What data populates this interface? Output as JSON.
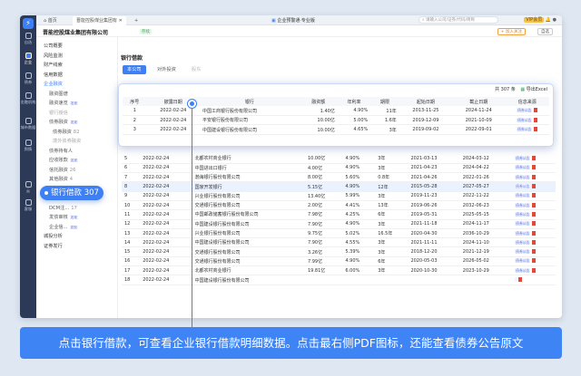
{
  "app": {
    "title": "企业预警通·专业版",
    "search_placeholder": "请输入公司/证券/代码/简称",
    "vip_label": "VIP会员"
  },
  "tabs": [
    {
      "label": "首页"
    },
    {
      "label": "晋能控股煤业集团有"
    }
  ],
  "company": {
    "name": "晋能控股煤业集团有限公司",
    "status_badge": "存续",
    "follow_label": "+ 加入关注",
    "select_label": "自选"
  },
  "rail": [
    {
      "label": "自选"
    },
    {
      "label": "企业"
    },
    {
      "label": "债券"
    },
    {
      "label": "金融机构"
    },
    {
      "label": "城市数据"
    },
    {
      "label": "舆情"
    },
    {
      "label": "云"
    },
    {
      "label": "客服"
    }
  ],
  "leftnav": [
    {
      "label": "公司概要"
    },
    {
      "label": "风险监测"
    },
    {
      "label": "财产线索"
    },
    {
      "label": "信用数据"
    },
    {
      "label": "企业融资"
    },
    {
      "label": "融资图谱"
    },
    {
      "label": "融资速览",
      "tag": "发现"
    },
    {
      "label": "银行授信"
    },
    {
      "label": "债券融资",
      "tag": "发现"
    },
    {
      "label": "债券融资",
      "count": "82"
    },
    {
      "label": "境外债券融资"
    },
    {
      "label": "债券持有人"
    },
    {
      "label": "应收账款",
      "tag": "发现"
    },
    {
      "label": "信托融资",
      "count": "26"
    },
    {
      "label": "其他融资",
      "count": "4"
    },
    {
      "label": "授信额度",
      "count": "40"
    },
    {
      "label": "DCM注...",
      "count": "69"
    },
    {
      "label": "DCM注...",
      "count": "17"
    },
    {
      "label": "发债审核",
      "tag": "发现"
    },
    {
      "label": "企业信...",
      "tag": "发现"
    },
    {
      "label": "城投分析"
    },
    {
      "label": "证券发行"
    }
  ],
  "callout": {
    "label": "银行借款",
    "count": "307"
  },
  "section": {
    "title": "银行借款",
    "subtabs": [
      "本公司",
      "对外投资",
      "股东"
    ]
  },
  "table": {
    "total_label": "共 307 条",
    "export_label": "导出Excel",
    "headers": [
      "序号",
      "披露日期",
      "银行",
      "融资额",
      "年利率",
      "期限",
      "起始日期",
      "截止日期",
      "信息来源"
    ],
    "top_rows": [
      {
        "no": "1",
        "date": "2022-02-24",
        "bank": "中国工商银行股份有限公司",
        "amount": "1.40亿",
        "rate": "4.90%",
        "term": "11年",
        "start": "2013-11-25",
        "end": "2024-11-24",
        "source": "债券公告"
      },
      {
        "no": "2",
        "date": "2022-02-24",
        "bank": "平安银行股份有限公司",
        "amount": "10.00亿",
        "rate": "5.00%",
        "term": "1.6年",
        "start": "2019-12-09",
        "end": "2021-10-09",
        "source": "债券公告"
      },
      {
        "no": "3",
        "date": "2022-02-24",
        "bank": "中国建设银行股份有限公司",
        "amount": "10.00亿",
        "rate": "4.65%",
        "term": "3年",
        "start": "2019-09-02",
        "end": "2022-09-01",
        "source": "债券公告"
      }
    ],
    "rows": [
      {
        "no": "5",
        "date": "2022-02-24",
        "bank": "北都农村商业银行",
        "amount": "10.00亿",
        "rate": "4.90%",
        "term": "3年",
        "start": "2021-03-13",
        "end": "2024-03-12",
        "source": "债券公告"
      },
      {
        "no": "6",
        "date": "2022-02-24",
        "bank": "中国进出口银行",
        "amount": "4.00亿",
        "rate": "4.90%",
        "term": "3年",
        "start": "2021-04-23",
        "end": "2024-04-22",
        "source": "债券公告"
      },
      {
        "no": "7",
        "date": "2022-02-24",
        "bank": "渤海银行股份有限公司",
        "amount": "8.00亿",
        "rate": "5.60%",
        "term": "0.8年",
        "start": "2021-04-26",
        "end": "2022-01-26",
        "source": "债券公告"
      },
      {
        "no": "8",
        "date": "2022-02-24",
        "bank": "国家开发银行",
        "amount": "5.15亿",
        "rate": "4.90%",
        "term": "12年",
        "start": "2015-05-28",
        "end": "2027-05-27",
        "source": "债券公告"
      },
      {
        "no": "9",
        "date": "2022-02-24",
        "bank": "兴业银行股份有限公司",
        "amount": "13.40亿",
        "rate": "5.99%",
        "term": "3年",
        "start": "2019-11-23",
        "end": "2022-11-22",
        "source": "债券公告"
      },
      {
        "no": "10",
        "date": "2022-02-24",
        "bank": "交通银行股份有限公司",
        "amount": "2.00亿",
        "rate": "4.41%",
        "term": "13年",
        "start": "2019-06-26",
        "end": "2032-06-23",
        "source": "债券公告"
      },
      {
        "no": "11",
        "date": "2022-02-24",
        "bank": "中国邮政储蓄银行股份有限公司",
        "amount": "7.98亿",
        "rate": "4.25%",
        "term": "6年",
        "start": "2019-05-31",
        "end": "2025-05-15",
        "source": "债券公告"
      },
      {
        "no": "12",
        "date": "2022-02-24",
        "bank": "中国建设银行股份有限公司",
        "amount": "7.90亿",
        "rate": "4.90%",
        "term": "3年",
        "start": "2021-11-18",
        "end": "2024-11-17",
        "source": "债券公告"
      },
      {
        "no": "13",
        "date": "2022-02-24",
        "bank": "兴业银行股份有限公司",
        "amount": "9.75亿",
        "rate": "5.02%",
        "term": "16.5年",
        "start": "2020-04-30",
        "end": "2036-10-29",
        "source": "债券公告"
      },
      {
        "no": "14",
        "date": "2022-02-24",
        "bank": "中国建设银行股份有限公司",
        "amount": "7.90亿",
        "rate": "4.55%",
        "term": "3年",
        "start": "2021-11-11",
        "end": "2024-11-10",
        "source": "债券公告"
      },
      {
        "no": "15",
        "date": "2022-02-24",
        "bank": "交通银行股份有限公司",
        "amount": "3.26亿",
        "rate": "5.39%",
        "term": "3年",
        "start": "2018-12-20",
        "end": "2021-12-19",
        "source": "债券公告"
      },
      {
        "no": "16",
        "date": "2022-02-24",
        "bank": "交通银行股份有限公司",
        "amount": "7.99亿",
        "rate": "4.90%",
        "term": "6年",
        "start": "2020-05-03",
        "end": "2026-05-02",
        "source": "债券公告"
      },
      {
        "no": "17",
        "date": "2022-02-24",
        "bank": "北都农村商业银行",
        "amount": "19.81亿",
        "rate": "6.00%",
        "term": "3年",
        "start": "2020-10-30",
        "end": "2023-10-29",
        "source": "债券公告"
      },
      {
        "no": "18",
        "date": "2022-02-24",
        "bank": "中国建设银行股份有限公司",
        "amount": "",
        "rate": "",
        "term": "",
        "start": "",
        "end": "",
        "source": ""
      }
    ]
  },
  "banner": {
    "text": "点击银行借款，可查看企业银行借款明细数据。点击最右侧PDF图标，还能查看债券公告原文"
  }
}
